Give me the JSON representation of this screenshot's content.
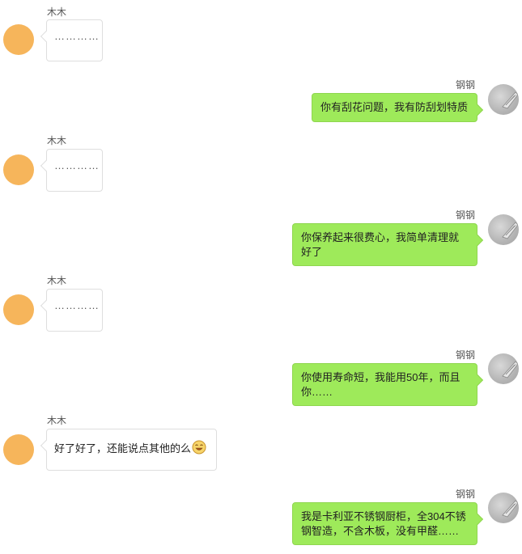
{
  "contacts": {
    "left_name": "木木",
    "right_name": "钢钢"
  },
  "messages": [
    {
      "side": "left",
      "sender": "木木",
      "text": "…………"
    },
    {
      "side": "right",
      "sender": "钢钢",
      "text": "你有刮花问题，我有防刮划特质"
    },
    {
      "side": "left",
      "sender": "木木",
      "text": "…………"
    },
    {
      "side": "right",
      "sender": "钢钢",
      "text": "你保养起来很费心，我简单清理就好了"
    },
    {
      "side": "left",
      "sender": "木木",
      "text": "…………"
    },
    {
      "side": "right",
      "sender": "钢钢",
      "text": "你使用寿命短，我能用50年，而且你……"
    },
    {
      "side": "left",
      "sender": "木木",
      "text": "好了好了，还能说点其他的么",
      "emoji": "laughing-face-icon"
    },
    {
      "side": "right",
      "sender": "钢钢",
      "text": "我是卡利亚不锈钢厨柜，全304不锈钢智造，不含木板，没有甲醛……"
    }
  ],
  "colors": {
    "left_avatar": "#f6b55b",
    "right_bubble": "#9eea5a",
    "left_bubble": "#ffffff"
  }
}
